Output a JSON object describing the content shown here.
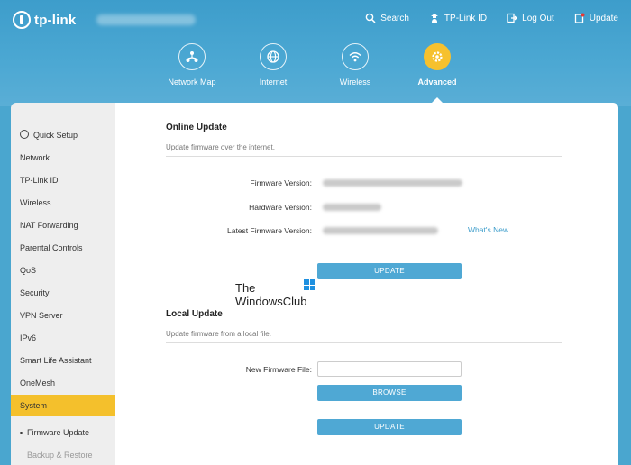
{
  "header": {
    "logo_text": "tp-link",
    "links": [
      {
        "label": "Search",
        "icon": "search-icon"
      },
      {
        "label": "TP-Link ID",
        "icon": "user-icon"
      },
      {
        "label": "Log Out",
        "icon": "logout-icon"
      },
      {
        "label": "Update",
        "icon": "update-icon"
      }
    ]
  },
  "nav": {
    "tabs": [
      {
        "label": "Network Map",
        "icon": "network-map-icon"
      },
      {
        "label": "Internet",
        "icon": "globe-icon"
      },
      {
        "label": "Wireless",
        "icon": "wifi-icon"
      },
      {
        "label": "Advanced",
        "icon": "gear-icon",
        "active": true
      }
    ]
  },
  "sidebar": {
    "items": [
      {
        "label": "Quick Setup"
      },
      {
        "label": "Network"
      },
      {
        "label": "TP-Link ID"
      },
      {
        "label": "Wireless"
      },
      {
        "label": "NAT Forwarding"
      },
      {
        "label": "Parental Controls"
      },
      {
        "label": "QoS"
      },
      {
        "label": "Security"
      },
      {
        "label": "VPN Server"
      },
      {
        "label": "IPv6"
      },
      {
        "label": "Smart Life Assistant"
      },
      {
        "label": "OneMesh"
      },
      {
        "label": "System",
        "active": true
      },
      {
        "label": "Firmware Update"
      },
      {
        "label": "Backup & Restore"
      }
    ]
  },
  "online_update": {
    "title": "Online Update",
    "description": "Update firmware over the internet.",
    "firmware_version_label": "Firmware Version:",
    "hardware_version_label": "Hardware Version:",
    "latest_firmware_label": "Latest Firmware Version:",
    "whats_new": "What's New",
    "update_button": "UPDATE"
  },
  "local_update": {
    "title": "Local Update",
    "description": "Update firmware from a local file.",
    "new_firmware_label": "New Firmware File:",
    "browse_button": "BROWSE",
    "update_button": "UPDATE"
  },
  "watermark": {
    "line1": "The",
    "line2": "WindowsClub"
  },
  "colors": {
    "header": "#4aa6cf",
    "accent": "#f4c02c",
    "button": "#4fa8d4",
    "link": "#3d9dcb"
  }
}
